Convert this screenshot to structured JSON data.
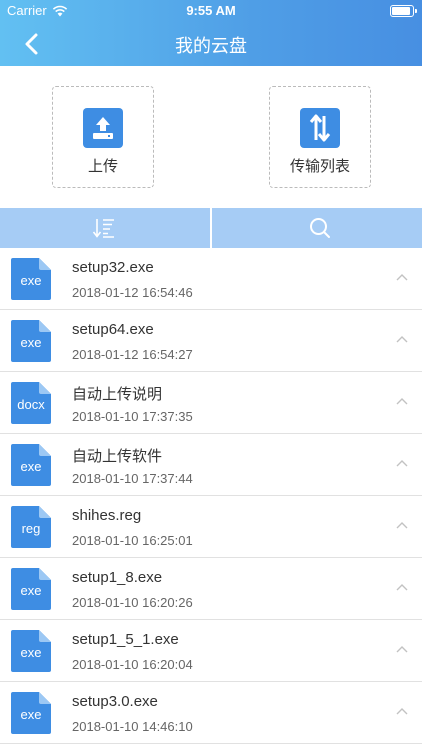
{
  "status_bar": {
    "carrier": "Carrier",
    "time": "9:55 AM"
  },
  "header": {
    "title": "我的云盘"
  },
  "actions": [
    {
      "label": "上传",
      "icon": "upload-icon"
    },
    {
      "label": "传输列表",
      "icon": "transfer-icon"
    }
  ],
  "toolbar": {
    "sort_icon": "sort-icon",
    "search_icon": "search-icon"
  },
  "colors": {
    "header_start": "#62c0f2",
    "header_end": "#478fe2",
    "accent": "#3e8de3",
    "toolbar": "#a6ccf5"
  },
  "files": [
    {
      "type": "exe",
      "name": "setup32.exe",
      "date": "2018-01-12 16:54:46"
    },
    {
      "type": "exe",
      "name": "setup64.exe",
      "date": "2018-01-12 16:54:27"
    },
    {
      "type": "docx",
      "name": "自动上传说明",
      "date": "2018-01-10 17:37:35"
    },
    {
      "type": "exe",
      "name": "自动上传软件",
      "date": "2018-01-10 17:37:44"
    },
    {
      "type": "reg",
      "name": "shihes.reg",
      "date": "2018-01-10 16:25:01"
    },
    {
      "type": "exe",
      "name": "setup1_8.exe",
      "date": "2018-01-10 16:20:26"
    },
    {
      "type": "exe",
      "name": "setup1_5_1.exe",
      "date": "2018-01-10 16:20:04"
    },
    {
      "type": "exe",
      "name": "setup3.0.exe",
      "date": "2018-01-10 14:46:10"
    }
  ]
}
